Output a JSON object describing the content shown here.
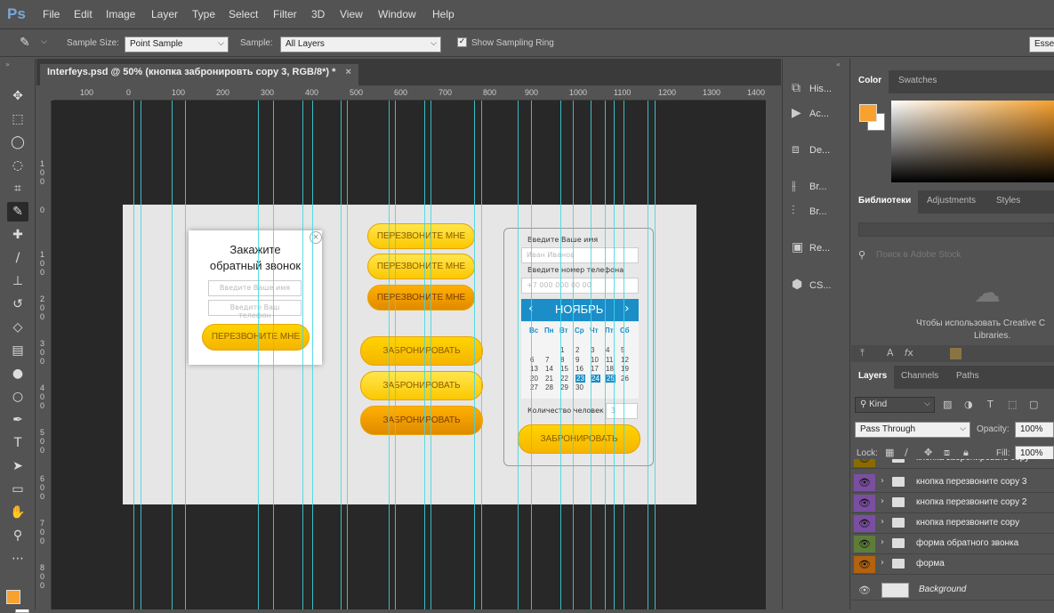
{
  "app": {
    "logo": "Ps"
  },
  "menu": [
    "File",
    "Edit",
    "Image",
    "Layer",
    "Type",
    "Select",
    "Filter",
    "3D",
    "View",
    "Window",
    "Help"
  ],
  "options": {
    "sample_size_label": "Sample Size:",
    "sample_size_value": "Point Sample",
    "sample_label": "Sample:",
    "sample_value": "All Layers",
    "show_ring_label": "Show Sampling Ring",
    "essentials": "Esse"
  },
  "document": {
    "tab_title": "Interfeys.psd @ 50% (кнопка забронировть copy 3, RGB/8*) *",
    "close": "×"
  },
  "ruler_h": [
    "100",
    "0",
    "100",
    "200",
    "300",
    "400",
    "500",
    "600",
    "700",
    "800",
    "900",
    "1000",
    "1100",
    "1200",
    "1300",
    "1400"
  ],
  "ruler_v": [
    "1",
    "0",
    "0",
    "1",
    "0",
    "0",
    "0",
    "1",
    "0",
    "0",
    "2",
    "0",
    "0",
    "3",
    "0",
    "0",
    "4",
    "0",
    "0",
    "5",
    "0",
    "0",
    "6",
    "0",
    "0",
    "7",
    "0",
    "0",
    "8",
    "0",
    "0"
  ],
  "canvas": {
    "popup": {
      "title_line1": "Закажите",
      "title_line2": "обратный звонок",
      "close": "×",
      "name_placeholder": "Введите Ваше имя",
      "phone_placeholder": "Введите Ваш телефон",
      "button": "ПЕРЕЗВОНИТЕ МНЕ"
    },
    "call_buttons": [
      "ПЕРЕЗВОНИТЕ МНЕ",
      "ПЕРЕЗВОНИТЕ МНЕ",
      "ПЕРЕЗВОНИТЕ МНЕ"
    ],
    "book_buttons": [
      "ЗАБРОНИРОВАТЬ",
      "ЗАБРОНИРОВАТЬ",
      "ЗАБРОНИРОВАТЬ"
    ],
    "booking": {
      "name_label": "Введите Ваше имя",
      "name_placeholder": "Иван Иванов",
      "phone_label": "Введите номер телефона",
      "phone_placeholder": "+7 000 000 00 00",
      "month": "НОЯБРЬ",
      "prev": "‹",
      "next": "›",
      "weekdays": [
        "Вс",
        "Пн",
        "Вт",
        "Ср",
        "Чт",
        "Пт",
        "Сб"
      ],
      "people_label": "Количество человек",
      "people_value": "3",
      "button": "ЗАБРОНИРОВАТЬ"
    }
  },
  "right_strip": [
    "His...",
    "Ac...",
    "De...",
    "Br...",
    "Br...",
    "Re...",
    "CS..."
  ],
  "color_panel": {
    "tabs": [
      "Color",
      "Swatches"
    ],
    "foreground": "#f7a12f"
  },
  "libraries": {
    "tabs": [
      "Библиотеки",
      "Adjustments",
      "Styles"
    ],
    "search_placeholder": "Поиск в Adobe Stock",
    "message_line1": "Чтобы использовать Creative C",
    "message_line2": "Libraries."
  },
  "layers_panel": {
    "tabs": [
      "Layers",
      "Channels",
      "Paths"
    ],
    "kind": "Kind",
    "blend": "Pass Through",
    "opacity_label": "Opacity:",
    "opacity": "100%",
    "lock_label": "Lock:",
    "fill_label": "Fill:",
    "fill": "100%",
    "layers": [
      {
        "name": "кнопка забронировать copy",
        "color": "#8b6b00"
      },
      {
        "name": "кнопка перезвоните copy 3",
        "color": "#7a4fa0"
      },
      {
        "name": "кнопка перезвоните copy 2",
        "color": "#7a4fa0"
      },
      {
        "name": "кнопка перезвоните copy",
        "color": "#7a4fa0"
      },
      {
        "name": "форма обратного звонка",
        "color": "#5e7d3a"
      },
      {
        "name": "форма",
        "color": "#b3620f"
      },
      {
        "name": "Background",
        "color": ""
      }
    ]
  }
}
